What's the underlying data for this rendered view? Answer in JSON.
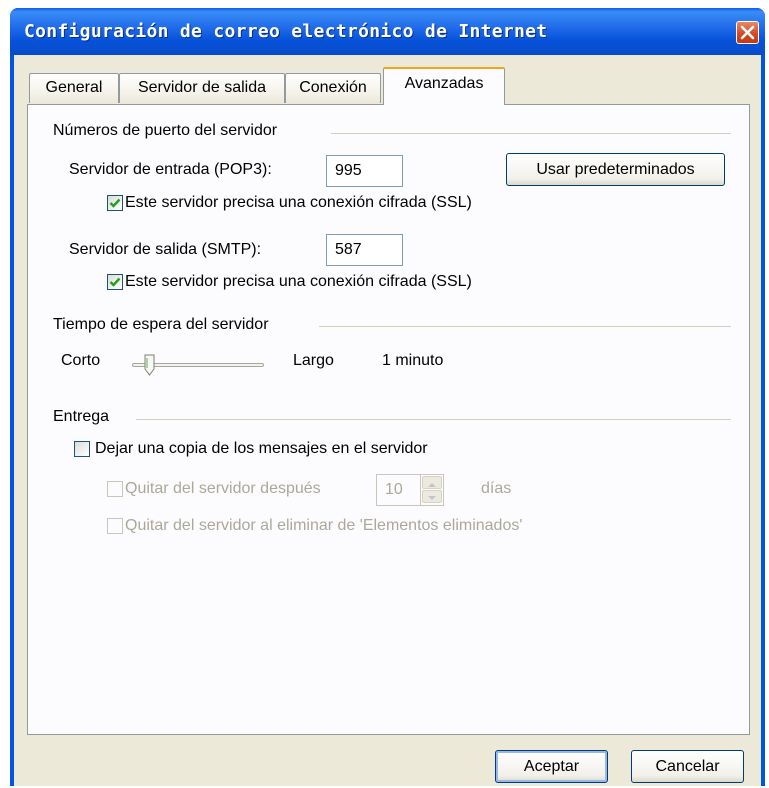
{
  "window": {
    "title": "Configuración de correo electrónico de Internet"
  },
  "tabs": [
    {
      "label": "General"
    },
    {
      "label": "Servidor de salida"
    },
    {
      "label": "Conexión"
    },
    {
      "label": "Avanzadas"
    }
  ],
  "ports": {
    "section_title": "Números de puerto del servidor",
    "incoming_label": "Servidor de entrada (POP3):",
    "incoming_value": "995",
    "defaults_button": "Usar predeterminados",
    "incoming_ssl_label": "Este servidor precisa una conexión cifrada (SSL)",
    "incoming_ssl_checked": true,
    "outgoing_label": "Servidor de salida (SMTP):",
    "outgoing_value": "587",
    "outgoing_ssl_label": "Este servidor precisa una conexión cifrada (SSL)",
    "outgoing_ssl_checked": true
  },
  "timeout": {
    "section_title": "Tiempo de espera del servidor",
    "short_label": "Corto",
    "long_label": "Largo",
    "value_text": "1 minuto",
    "level": 0.0
  },
  "delivery": {
    "section_title": "Entrega",
    "leave_copy_label": "Dejar una copia de los mensajes en el servidor",
    "leave_copy_checked": false,
    "remove_after_label": "Quitar del servidor después",
    "remove_after_days": "10",
    "days_label": "días",
    "remove_deleted_label": "Quitar del servidor al eliminar de 'Elementos eliminados'"
  },
  "buttons": {
    "ok": "Aceptar",
    "cancel": "Cancelar"
  },
  "colors": {
    "titlebar": "#0054e3",
    "dialog_bg": "#ece9d8",
    "tab_highlight": "#f5a51a",
    "check": "#21a121"
  }
}
